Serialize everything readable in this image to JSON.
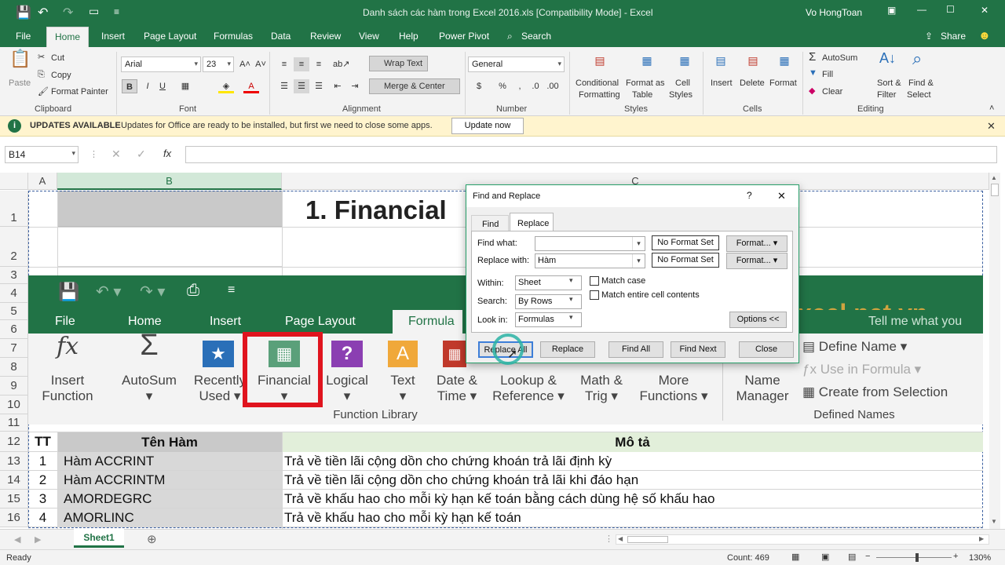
{
  "window": {
    "title": "Danh sách các hàm trong Excel 2016.xls  [Compatibility Mode]  -  Excel",
    "user": "Vo HongToan",
    "minimize": "—",
    "restore": "☐",
    "close": "✕"
  },
  "ribbon_tabs": [
    "File",
    "Home",
    "Insert",
    "Page Layout",
    "Formulas",
    "Data",
    "Review",
    "View",
    "Help",
    "Power Pivot"
  ],
  "search_label": "Search",
  "share_label": "Share",
  "clipboard": {
    "paste": "Paste",
    "cut": "Cut",
    "copy": "Copy",
    "format_painter": "Format Painter",
    "group": "Clipboard"
  },
  "font": {
    "name": "Arial",
    "size": "23",
    "bold": "B",
    "italic": "I",
    "underline": "U",
    "group": "Font"
  },
  "alignment": {
    "wrap_text": "Wrap Text",
    "merge_center": "Merge & Center",
    "group": "Alignment"
  },
  "number": {
    "format": "General",
    "percent": "%",
    "group": "Number"
  },
  "styles": {
    "conditional": "Conditional",
    "conditional2": "Formatting",
    "format_as": "Format as",
    "table": "Table",
    "cell": "Cell",
    "cell2": "Styles",
    "group": "Styles"
  },
  "cells": {
    "insert": "Insert",
    "delete": "Delete",
    "format": "Format",
    "group": "Cells"
  },
  "editing": {
    "autosum": "AutoSum",
    "fill": "Fill",
    "clear": "Clear",
    "sort": "Sort &",
    "sort2": "Filter",
    "find": "Find &",
    "find2": "Select",
    "group": "Editing"
  },
  "update_bar": {
    "badge": "UPDATES AVAILABLE",
    "message": "Updates for Office are ready to be installed, but first we need to close some apps.",
    "button": "Update now"
  },
  "name_box": "B14",
  "fx": "fx",
  "columns": [
    "A",
    "B",
    "C"
  ],
  "rows": [
    "1",
    "2",
    "3",
    "4",
    "5",
    "6",
    "7",
    "8",
    "9",
    "10",
    "11",
    "12",
    "13",
    "14",
    "15",
    "16"
  ],
  "heading_cell": "1. Financial",
  "inner_ribbon": {
    "tabs": [
      "File",
      "Home",
      "Insert",
      "Page Layout",
      "Formula"
    ],
    "buttons": [
      {
        "l1": "Insert",
        "l2": "Function",
        "icon": "fx"
      },
      {
        "l1": "AutoSum",
        "l2": "▾",
        "icon": "Σ"
      },
      {
        "l1": "Recently",
        "l2": "Used ▾",
        "icon": "★"
      },
      {
        "l1": "Financial",
        "l2": "▾",
        "icon": "▦"
      },
      {
        "l1": "Logical",
        "l2": "▾",
        "icon": "?"
      },
      {
        "l1": "Text",
        "l2": "▾",
        "icon": "A"
      },
      {
        "l1": "Date &",
        "l2": "Time ▾",
        "icon": "▦"
      },
      {
        "l1": "Lookup &",
        "l2": "Reference ▾",
        "icon": "▦"
      },
      {
        "l1": "Math &",
        "l2": "Trig ▾",
        "icon": "θ"
      },
      {
        "l1": "More",
        "l2": "Functions ▾",
        "icon": "▦"
      },
      {
        "l1": "Name",
        "l2": "Manager",
        "icon": "▦"
      }
    ],
    "library_group": "Function Library",
    "define_name": "Define Name",
    "use_in_formula": "Use in Formula",
    "create_from_selection": "Create from Selection",
    "defined_names_group": "Defined Names",
    "watermark": "xcel.net.vn",
    "tell_me": "Tell me what you"
  },
  "table": {
    "headers": [
      "TT",
      "Tên Hàm",
      "Mô tả"
    ],
    "rows": [
      {
        "tt": "1",
        "name": "Hàm ACCRINT",
        "desc": "Trả về tiền lãi cộng dồn cho chứng khoán trả lãi định kỳ"
      },
      {
        "tt": "2",
        "name": "Hàm ACCRINTM",
        "desc": "Trả về tiền lãi cộng dồn cho chứng khoán trả lãi khi đáo hạn"
      },
      {
        "tt": "3",
        "name": "AMORDEGRC",
        "desc": "Trả về khấu hao cho mỗi kỳ hạn kế toán bằng cách dùng hệ số khấu hao"
      },
      {
        "tt": "4",
        "name": "AMORLINC",
        "desc": "Trả về khấu hao cho mỗi kỳ hạn kế toán"
      }
    ]
  },
  "dialog": {
    "title": "Find and Replace",
    "help": "?",
    "close": "✕",
    "tabs": [
      "Find",
      "Replace"
    ],
    "find_what_label": "Find what:",
    "find_what_value": "",
    "replace_with_label": "Replace with:",
    "replace_with_value": "Hàm",
    "no_format": "No Format Set",
    "format_btn": "Format...",
    "within_label": "Within:",
    "within_value": "Sheet",
    "search_label": "Search:",
    "search_value": "By Rows",
    "lookin_label": "Look in:",
    "lookin_value": "Formulas",
    "match_case": "Match case",
    "match_entire": "Match entire cell contents",
    "options": "Options <<",
    "replace_all": "Replace All",
    "replace": "Replace",
    "find_all": "Find All",
    "find_next": "Find Next",
    "close_btn": "Close"
  },
  "sheet_tab": "Sheet1",
  "status": {
    "ready": "Ready",
    "count": "Count: 469",
    "zoom": "130%"
  },
  "colors": {
    "excel_green": "#217346",
    "highlight_red": "#e0141e",
    "cursor_teal": "#2ab3a4",
    "update_yellow": "#fff4ce"
  }
}
